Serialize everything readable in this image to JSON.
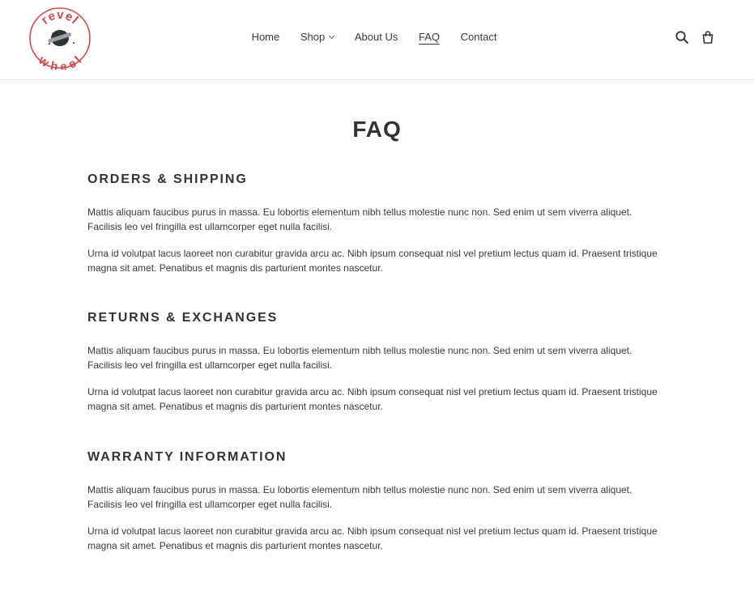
{
  "brand": {
    "logo_top_text": "revel",
    "logo_bottom_text": "wheel",
    "accent_color": "#d04a4f"
  },
  "nav": {
    "items": [
      {
        "label": "Home"
      },
      {
        "label": "Shop"
      },
      {
        "label": "About Us"
      },
      {
        "label": "FAQ"
      },
      {
        "label": "Contact"
      }
    ],
    "active": "FAQ"
  },
  "header_icons": [
    "search-icon",
    "cart-icon"
  ],
  "page": {
    "title": "FAQ",
    "sections": [
      {
        "title": "ORDERS & SHIPPING",
        "paragraphs": [
          "Mattis aliquam faucibus purus in massa. Eu lobortis elementum nibh tellus molestie nunc non. Sed enim ut sem viverra aliquet. Facilisis leo vel fringilla est ullamcorper eget nulla facilisi.",
          "Urna id volutpat lacus laoreet non curabitur gravida arcu ac. Nibh ipsum consequat nisl vel pretium lectus quam id. Praesent tristique magna sit amet. Penatibus et magnis dis parturient montes nascetur."
        ]
      },
      {
        "title": "RETURNS & EXCHANGES",
        "paragraphs": [
          "Mattis aliquam faucibus purus in massa. Eu lobortis elementum nibh tellus molestie nunc non. Sed enim ut sem viverra aliquet. Facilisis leo vel fringilla est ullamcorper eget nulla facilisi.",
          "Urna id volutpat lacus laoreet non curabitur gravida arcu ac. Nibh ipsum consequat nisl vel pretium lectus quam id. Praesent tristique magna sit amet. Penatibus et magnis dis parturient montes nascetur."
        ]
      },
      {
        "title": "WARRANTY INFORMATION",
        "paragraphs": [
          "Mattis aliquam faucibus purus in massa. Eu lobortis elementum nibh tellus molestie nunc non. Sed enim ut sem viverra aliquet. Facilisis leo vel fringilla est ullamcorper eget nulla facilisi.",
          "Urna id volutpat lacus laoreet non curabitur gravida arcu ac. Nibh ipsum consequat nisl vel pretium lectus quam id. Praesent tristique magna sit amet. Penatibus et magnis dis parturient montes nascetur."
        ]
      }
    ]
  }
}
